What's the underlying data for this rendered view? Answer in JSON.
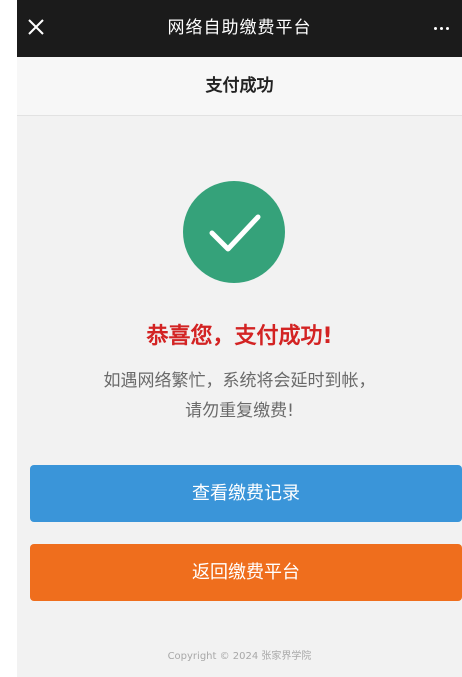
{
  "topbar": {
    "close_icon": "close-icon",
    "title": "网络自助缴费平台",
    "more_icon": "more-icon"
  },
  "subheader": {
    "title": "支付成功"
  },
  "status": {
    "icon": "checkmark-icon",
    "title": "恭喜您，支付成功!",
    "notice_line1": "如遇网络繁忙，系统将会延时到帐，",
    "notice_line2": "请勿重复缴费!"
  },
  "actions": {
    "view_records_label": "查看缴费记录",
    "return_label": "返回缴费平台"
  },
  "footer": {
    "copyright": "Copyright © 2024 张家界学院"
  },
  "colors": {
    "topbar_bg": "#1b1b1b",
    "success_green": "#35a27a",
    "title_red": "#d32323",
    "primary_blue": "#3a95d9",
    "accent_orange": "#ef6e1d"
  }
}
